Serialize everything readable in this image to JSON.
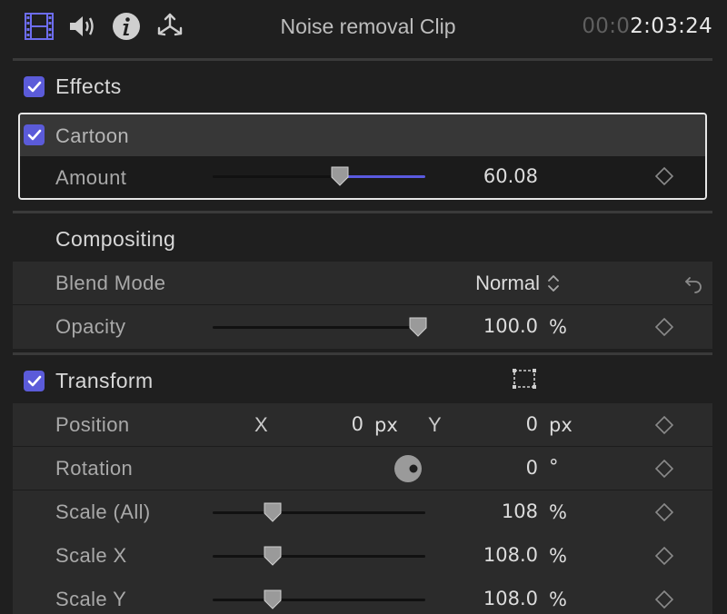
{
  "header": {
    "title": "Noise removal Clip",
    "timecode_dim": "00:0",
    "timecode_bright": "2:03:24",
    "icons": [
      "film-icon",
      "speaker-icon",
      "info-icon",
      "transform-move-icon"
    ]
  },
  "effects": {
    "label": "Effects",
    "enabled": true,
    "cartoon": {
      "label": "Cartoon",
      "enabled": true,
      "amount": {
        "label": "Amount",
        "value": "60.08",
        "fraction": 0.6
      }
    }
  },
  "compositing": {
    "label": "Compositing",
    "blend_mode": {
      "label": "Blend Mode",
      "value": "Normal"
    },
    "opacity": {
      "label": "Opacity",
      "value": "100.0",
      "unit": "%",
      "fraction": 1.0
    }
  },
  "transform": {
    "label": "Transform",
    "enabled": true,
    "position": {
      "label": "Position",
      "x_label": "X",
      "x_value": "0",
      "x_unit": "px",
      "y_label": "Y",
      "y_value": "0",
      "y_unit": "px"
    },
    "rotation": {
      "label": "Rotation",
      "value": "0",
      "unit": "°"
    },
    "scale_all": {
      "label": "Scale (All)",
      "value": "108",
      "unit": "%",
      "fraction": 0.3
    },
    "scale_x": {
      "label": "Scale X",
      "value": "108.0",
      "unit": "%",
      "fraction": 0.3
    },
    "scale_y": {
      "label": "Scale Y",
      "value": "108.0",
      "unit": "%",
      "fraction": 0.3
    }
  },
  "colors": {
    "accent": "#5b5bd9",
    "background": "#1f1f1f",
    "row_shade": "#2b2b2b"
  }
}
